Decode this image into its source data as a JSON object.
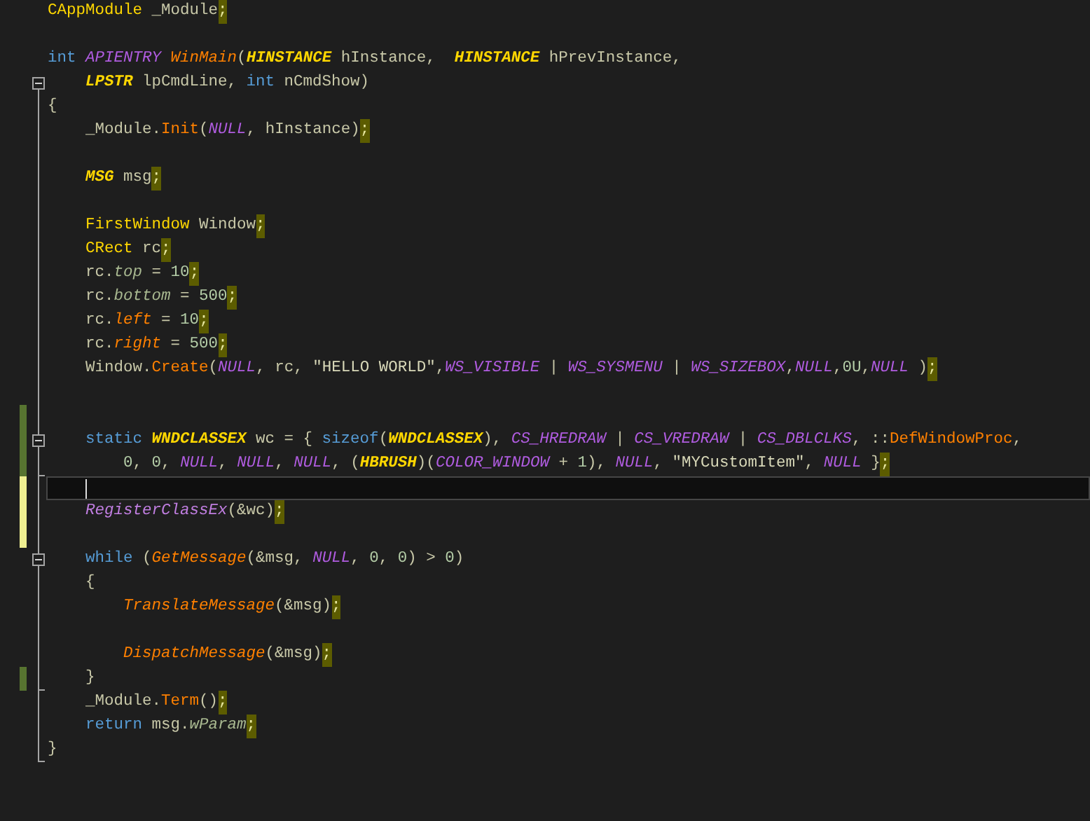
{
  "lines": [
    {
      "blank_line_after": true,
      "tokens": [
        {
          "text": "CAppModule",
          "kind": "class"
        },
        {
          "text": " _Module",
          "kind": "plain"
        },
        {
          "text": ";",
          "kind": "mark"
        }
      ]
    },
    {
      "tokens": [
        {
          "text": "int ",
          "kind": "keyword"
        },
        {
          "text": "APIENTRY ",
          "kind": "macro"
        },
        {
          "text": "WinMain",
          "kind": "call-italic"
        },
        {
          "text": "(",
          "kind": "plain"
        },
        {
          "text": "HINSTANCE",
          "kind": "type"
        },
        {
          "text": " hInstance,  ",
          "kind": "plain"
        },
        {
          "text": "HINSTANCE",
          "kind": "type"
        },
        {
          "text": " hPrevInstance,",
          "kind": "plain"
        }
      ]
    },
    {
      "collapsible": true,
      "tokens": [
        {
          "text": "    LPSTR",
          "kind": "type"
        },
        {
          "text": " lpCmdLine, ",
          "kind": "plain"
        },
        {
          "text": "int",
          "kind": "keyword"
        },
        {
          "text": " nCmdShow)",
          "kind": "plain"
        }
      ]
    },
    {
      "tokens": [
        {
          "text": "{",
          "kind": "plain"
        }
      ]
    },
    {
      "blank_line_after": true,
      "tokens": [
        {
          "text": "    _Module.",
          "kind": "plain"
        },
        {
          "text": "Init",
          "kind": "call"
        },
        {
          "text": "(",
          "kind": "plain"
        },
        {
          "text": "NULL",
          "kind": "macro"
        },
        {
          "text": ", hInstance)",
          "kind": "plain"
        },
        {
          "text": ";",
          "kind": "mark"
        }
      ]
    },
    {
      "blank_line_after": true,
      "tokens": [
        {
          "text": "    MSG",
          "kind": "type"
        },
        {
          "text": " msg",
          "kind": "plain"
        },
        {
          "text": ";",
          "kind": "mark"
        }
      ]
    },
    {
      "tokens": [
        {
          "text": "    FirstWindow",
          "kind": "class"
        },
        {
          "text": " Window",
          "kind": "plain"
        },
        {
          "text": ";",
          "kind": "mark"
        }
      ]
    },
    {
      "tokens": [
        {
          "text": "    CRect",
          "kind": "class"
        },
        {
          "text": " rc",
          "kind": "plain"
        },
        {
          "text": ";",
          "kind": "mark"
        }
      ]
    },
    {
      "tokens": [
        {
          "text": "    rc.",
          "kind": "plain"
        },
        {
          "text": "top",
          "kind": "field"
        },
        {
          "text": " = ",
          "kind": "plain"
        },
        {
          "text": "10",
          "kind": "number"
        },
        {
          "text": ";",
          "kind": "mark"
        }
      ]
    },
    {
      "tokens": [
        {
          "text": "    rc.",
          "kind": "plain"
        },
        {
          "text": "bottom",
          "kind": "field"
        },
        {
          "text": " = ",
          "kind": "plain"
        },
        {
          "text": "500",
          "kind": "number"
        },
        {
          "text": ";",
          "kind": "mark"
        }
      ]
    },
    {
      "tokens": [
        {
          "text": "    rc.",
          "kind": "plain"
        },
        {
          "text": "left",
          "kind": "field-orange"
        },
        {
          "text": " = ",
          "kind": "plain"
        },
        {
          "text": "10",
          "kind": "number"
        },
        {
          "text": ";",
          "kind": "mark"
        }
      ]
    },
    {
      "tokens": [
        {
          "text": "    rc.",
          "kind": "plain"
        },
        {
          "text": "right",
          "kind": "field-orange"
        },
        {
          "text": " = ",
          "kind": "plain"
        },
        {
          "text": "500",
          "kind": "number"
        },
        {
          "text": ";",
          "kind": "mark"
        }
      ]
    },
    {
      "blank_line_after": true,
      "tokens": [
        {
          "text": "    Window.",
          "kind": "plain"
        },
        {
          "text": "Create",
          "kind": "call"
        },
        {
          "text": "(",
          "kind": "plain"
        },
        {
          "text": "NULL",
          "kind": "macro"
        },
        {
          "text": ", rc, ",
          "kind": "plain"
        },
        {
          "text": "\"HELLO WORLD\"",
          "kind": "string"
        },
        {
          "text": ",",
          "kind": "plain"
        },
        {
          "text": "WS_VISIBLE",
          "kind": "macro"
        },
        {
          "text": " | ",
          "kind": "plain"
        },
        {
          "text": "WS_SYSMENU",
          "kind": "macro"
        },
        {
          "text": " | ",
          "kind": "plain"
        },
        {
          "text": "WS_SIZEBOX",
          "kind": "macro"
        },
        {
          "text": ",",
          "kind": "plain"
        },
        {
          "text": "NULL",
          "kind": "macro"
        },
        {
          "text": ",",
          "kind": "plain"
        },
        {
          "text": "0U",
          "kind": "number"
        },
        {
          "text": ",",
          "kind": "plain"
        },
        {
          "text": "NULL",
          "kind": "macro"
        },
        {
          "text": " )",
          "kind": "plain"
        },
        {
          "text": ";",
          "kind": "mark"
        }
      ]
    },
    {
      "modified": true,
      "saved": true
    },
    {
      "modified": true,
      "saved": true,
      "collapsible": true,
      "tokens": [
        {
          "text": "    static ",
          "kind": "keyword"
        },
        {
          "text": "WNDCLASSEX",
          "kind": "type"
        },
        {
          "text": " wc = { ",
          "kind": "plain"
        },
        {
          "text": "sizeof",
          "kind": "keyword"
        },
        {
          "text": "(",
          "kind": "plain"
        },
        {
          "text": "WNDCLASSEX",
          "kind": "type"
        },
        {
          "text": "), ",
          "kind": "plain"
        },
        {
          "text": "CS_HREDRAW",
          "kind": "macro"
        },
        {
          "text": " | ",
          "kind": "plain"
        },
        {
          "text": "CS_VREDRAW",
          "kind": "macro"
        },
        {
          "text": " | ",
          "kind": "plain"
        },
        {
          "text": "CS_DBLCLKS",
          "kind": "macro"
        },
        {
          "text": ", ::",
          "kind": "plain"
        },
        {
          "text": "DefWindowProc",
          "kind": "call"
        },
        {
          "text": ",",
          "kind": "plain"
        }
      ]
    },
    {
      "modified": true,
      "saved": true,
      "block_end": true,
      "tokens": [
        {
          "text": "        0",
          "kind": "number"
        },
        {
          "text": ", ",
          "kind": "plain"
        },
        {
          "text": "0",
          "kind": "number"
        },
        {
          "text": ", ",
          "kind": "plain"
        },
        {
          "text": "NULL",
          "kind": "macro"
        },
        {
          "text": ", ",
          "kind": "plain"
        },
        {
          "text": "NULL",
          "kind": "macro"
        },
        {
          "text": ", ",
          "kind": "plain"
        },
        {
          "text": "NULL",
          "kind": "macro"
        },
        {
          "text": ", (",
          "kind": "plain"
        },
        {
          "text": "HBRUSH",
          "kind": "type"
        },
        {
          "text": ")(",
          "kind": "plain"
        },
        {
          "text": "COLOR_WINDOW",
          "kind": "macro"
        },
        {
          "text": " + ",
          "kind": "plain"
        },
        {
          "text": "1",
          "kind": "number"
        },
        {
          "text": "), ",
          "kind": "plain"
        },
        {
          "text": "NULL",
          "kind": "macro"
        },
        {
          "text": ", ",
          "kind": "plain"
        },
        {
          "text": "\"MYCustomItem\"",
          "kind": "string"
        },
        {
          "text": ", ",
          "kind": "plain"
        },
        {
          "text": "NULL",
          "kind": "macro"
        },
        {
          "text": " }",
          "kind": "plain"
        },
        {
          "text": ";",
          "kind": "mark"
        }
      ]
    },
    {
      "modified": true,
      "saved": false,
      "current": true
    },
    {
      "modified": true,
      "saved": false,
      "tokens": [
        {
          "text": "    RegisterClassEx",
          "kind": "api"
        },
        {
          "text": "(&wc)",
          "kind": "plain"
        },
        {
          "text": ";",
          "kind": "mark"
        }
      ]
    },
    {
      "modified": true,
      "saved": false
    },
    {
      "collapsible": true,
      "tokens": [
        {
          "text": "    while",
          "kind": "keyword"
        },
        {
          "text": " (",
          "kind": "plain"
        },
        {
          "text": "GetMessage",
          "kind": "call-italic"
        },
        {
          "text": "(&msg, ",
          "kind": "plain"
        },
        {
          "text": "NULL",
          "kind": "macro"
        },
        {
          "text": ", ",
          "kind": "plain"
        },
        {
          "text": "0",
          "kind": "number"
        },
        {
          "text": ", ",
          "kind": "plain"
        },
        {
          "text": "0",
          "kind": "number"
        },
        {
          "text": ") > ",
          "kind": "plain"
        },
        {
          "text": "0",
          "kind": "number"
        },
        {
          "text": ")",
          "kind": "plain"
        }
      ]
    },
    {
      "tokens": [
        {
          "text": "    {",
          "kind": "plain"
        }
      ]
    },
    {
      "blank_line_after": true,
      "tokens": [
        {
          "text": "        TranslateMessage",
          "kind": "call-italic"
        },
        {
          "text": "(&msg)",
          "kind": "plain"
        },
        {
          "text": ";",
          "kind": "mark"
        }
      ]
    },
    {
      "tokens": [
        {
          "text": "        DispatchMessage",
          "kind": "call-italic"
        },
        {
          "text": "(&msg)",
          "kind": "plain"
        },
        {
          "text": ";",
          "kind": "mark"
        }
      ]
    },
    {
      "modified": true,
      "saved": true,
      "block_end": true,
      "tokens": [
        {
          "text": "    }",
          "kind": "plain"
        }
      ]
    },
    {
      "tokens": [
        {
          "text": "    _Module.",
          "kind": "plain"
        },
        {
          "text": "Term",
          "kind": "call"
        },
        {
          "text": "()",
          "kind": "plain"
        },
        {
          "text": ";",
          "kind": "mark"
        }
      ]
    },
    {
      "tokens": [
        {
          "text": "    return",
          "kind": "keyword"
        },
        {
          "text": " msg.",
          "kind": "plain"
        },
        {
          "text": "wParam",
          "kind": "field"
        },
        {
          "text": ";",
          "kind": "mark"
        }
      ]
    },
    {
      "block_end": true,
      "tokens": [
        {
          "text": "}",
          "kind": "plain"
        }
      ]
    }
  ]
}
